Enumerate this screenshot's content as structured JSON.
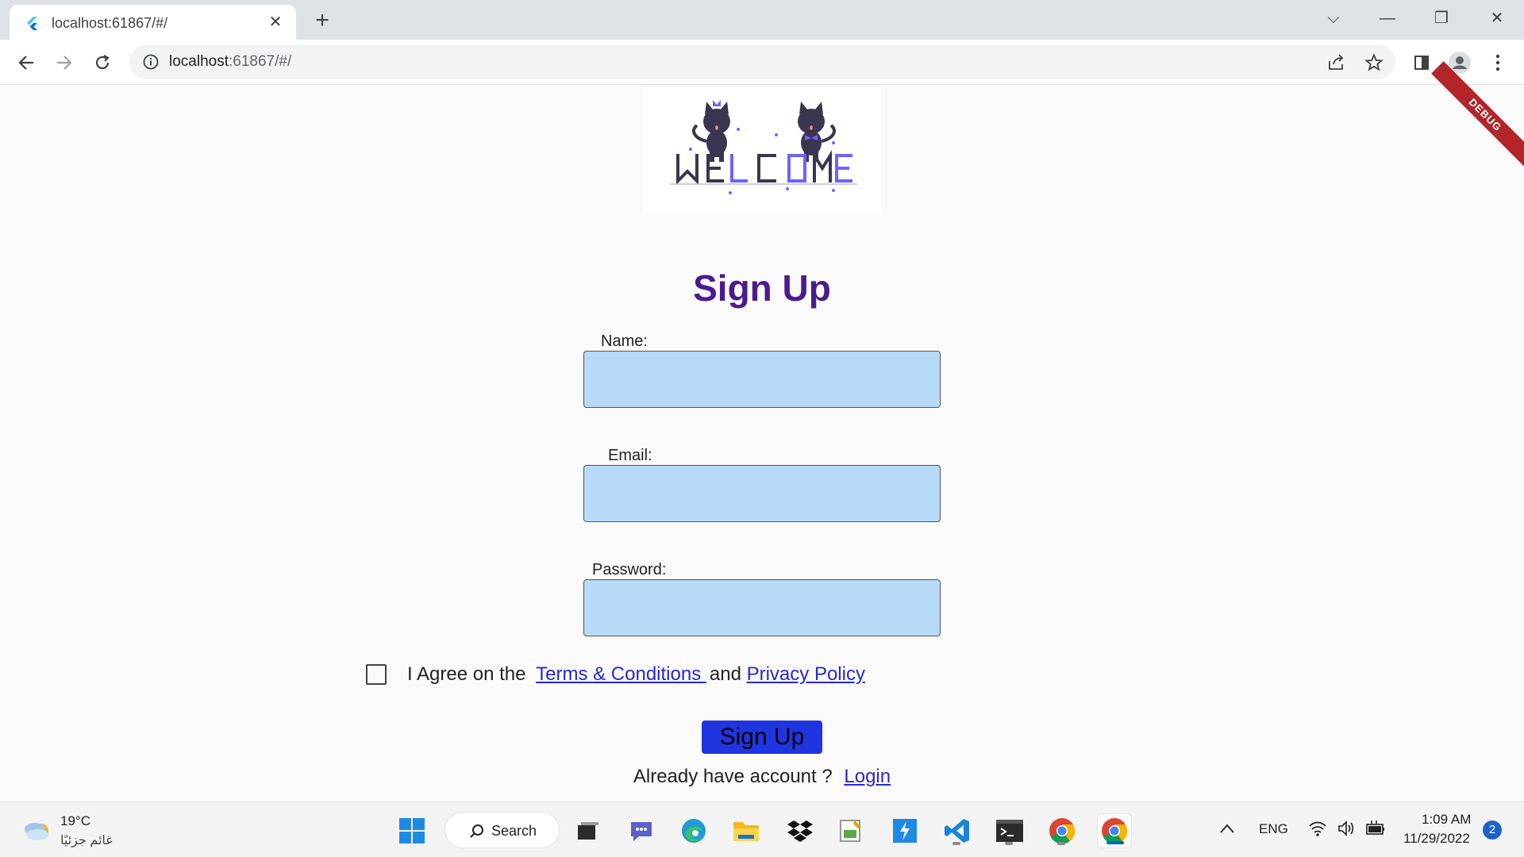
{
  "browser": {
    "tab_title": "localhost:61867/#/",
    "tab_close": "✕",
    "new_tab": "+",
    "url_host": "localhost",
    "url_rest": ":61867/#/",
    "window_controls": {
      "tab_search": "⌵",
      "minimize": "—",
      "restore": "❐",
      "close": "✕"
    }
  },
  "page": {
    "debug_banner": "DEBUG",
    "logo_alt": "WELCOME",
    "heading": "Sign Up",
    "name_label": "Name:",
    "email_label": "Email:",
    "password_label": "Password:",
    "name_value": "",
    "email_value": "",
    "password_value": "",
    "agree_prefix": "I Agree on the",
    "terms_link": "Terms & Conditions ",
    "agree_and": "and",
    "privacy_link": "Privacy Policy",
    "signup_button": "Sign Up",
    "already_text": "Already have account ?",
    "login_link": "Login"
  },
  "taskbar": {
    "weather_temp": "19°C",
    "weather_desc": "غائم جزئيًا",
    "search_label": "Search",
    "language": "ENG",
    "time": "1:09 AM",
    "date": "11/29/2022",
    "notification_count": "2"
  },
  "colors": {
    "heading": "#4b1a8f",
    "field_bg": "#b7daf9",
    "link": "#2727d6",
    "button_bg": "#1f35e0",
    "debug_banner": "#b1252b"
  }
}
